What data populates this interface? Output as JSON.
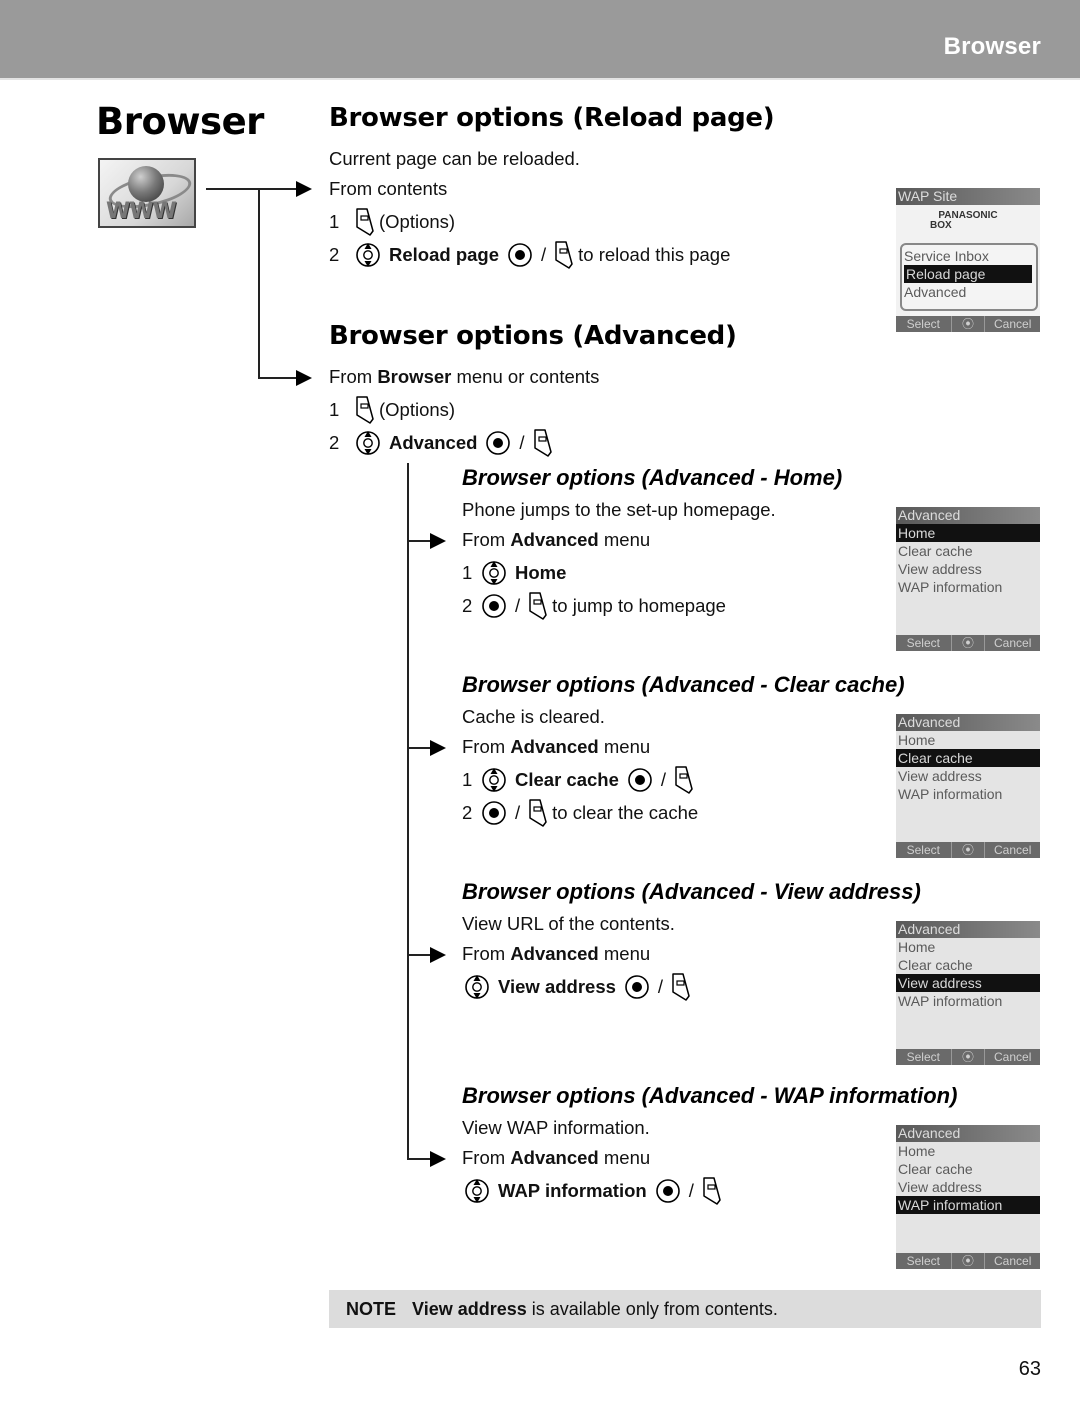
{
  "header": {
    "section_title": "Browser"
  },
  "chapter": {
    "title": "Browser",
    "icon": "www-globe-icon",
    "icon_text": "WWW"
  },
  "reload": {
    "title": "Browser options (Reload page)",
    "description": "Current page can be reloaded.",
    "from": "From contents",
    "steps": [
      {
        "num": "1",
        "icons": [
          "soft-key-icon"
        ],
        "text": "(Options)"
      },
      {
        "num": "2",
        "icons": [
          "navigation-key-icon"
        ],
        "bold": "Reload page",
        "after_icons": [
          "select-key-icon",
          "soft-key-icon"
        ],
        "separator": "/",
        "text": "to reload this page"
      }
    ],
    "screen": {
      "title": "WAP Site",
      "logo_line1": "PANASONIC",
      "logo_line2": "BOX",
      "items": [
        "Service Inbox",
        "Reload page",
        "Advanced"
      ],
      "selected": "Reload page",
      "softkeys": [
        "Select",
        "⦿",
        "Cancel"
      ]
    }
  },
  "advanced": {
    "title": "Browser options (Advanced)",
    "from_prefix": "From ",
    "from_bold": "Browser",
    "from_suffix": " menu or contents",
    "steps": [
      {
        "num": "1",
        "text": "(Options)"
      },
      {
        "num": "2",
        "bold": "Advanced",
        "separator": "/"
      }
    ]
  },
  "subsections": [
    {
      "title": "Browser options (Advanced - Home)",
      "description": "Phone jumps to the set-up homepage.",
      "from_prefix": "From ",
      "from_bold": "Advanced",
      "from_suffix": " menu",
      "step1_num": "1",
      "step1_bold": "Home",
      "step2_num": "2",
      "separator": "/",
      "step2_text": "to jump to homepage",
      "screen_selected_index": 0
    },
    {
      "title": "Browser options (Advanced - Clear cache)",
      "description": "Cache is cleared.",
      "from_prefix": "From ",
      "from_bold": "Advanced",
      "from_suffix": " menu",
      "step1_num": "1",
      "step1_bold": "Clear cache",
      "step2_num": "2",
      "separator": "/",
      "step2_text": "to clear the cache",
      "screen_selected_index": 1
    },
    {
      "title": "Browser options (Advanced - View address)",
      "description": "View URL of the contents.",
      "from_prefix": "From ",
      "from_bold": "Advanced",
      "from_suffix": " menu",
      "step1_bold": "View address",
      "separator": "/",
      "screen_selected_index": 2
    },
    {
      "title": "Browser options (Advanced - WAP information)",
      "description": "View WAP information.",
      "from_prefix": "From ",
      "from_bold": "Advanced",
      "from_suffix": " menu",
      "step1_bold": "WAP information",
      "separator": "/",
      "screen_selected_index": 3
    }
  ],
  "advanced_screen": {
    "title": "Advanced",
    "items": [
      "Home",
      "Clear cache",
      "View address",
      "WAP information"
    ],
    "softkeys": [
      "Select",
      "⦿",
      "Cancel"
    ]
  },
  "note": {
    "label": "NOTE",
    "bold": "View address",
    "text": " is available only from contents."
  },
  "page_number": "63"
}
